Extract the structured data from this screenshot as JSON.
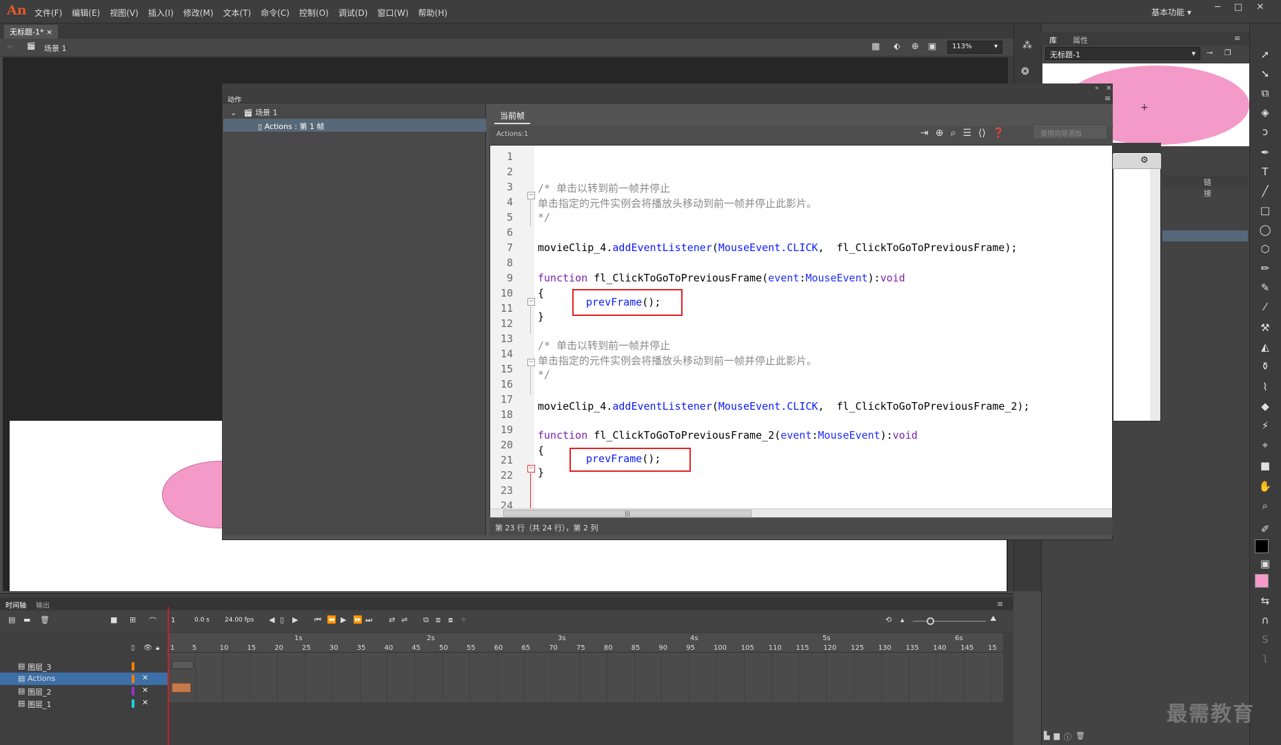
{
  "app": {
    "logo": "An",
    "menu": [
      "文件(F)",
      "编辑(E)",
      "视图(V)",
      "插入(I)",
      "修改(M)",
      "文本(T)",
      "命令(C)",
      "控制(O)",
      "调试(D)",
      "窗口(W)",
      "帮助(H)"
    ],
    "workspace": "基本功能"
  },
  "document": {
    "tab": "无标题-1*",
    "scene": "场景 1",
    "zoom": "113%"
  },
  "actions_panel": {
    "title": "动作",
    "tree_scene": "场景 1",
    "tree_item": "Actions : 第 1 帧",
    "code_tab": "当前帧",
    "code_label": "Actions:1",
    "wizard_button": "使用向导添加",
    "status": "第 23 行（共 24 行），第 2 列"
  },
  "code": {
    "line_numbers": [
      "1",
      "2",
      "3",
      "4",
      "5",
      "6",
      "7",
      "8",
      "9",
      "10",
      "11",
      "12",
      "13",
      "14",
      "15",
      "16",
      "17",
      "18",
      "19",
      "20",
      "21",
      "22",
      "23",
      "24"
    ],
    "comment1": "/* 单击以转到前一帧并停止",
    "comment2": "单击指定的元件实例会将播放头移动到前一帧并停止此影片。",
    "comment3": "*/",
    "l7_a": "movieClip_4.",
    "l7_b": "addEventListener",
    "l7_c": "(",
    "l7_d": "MouseEvent.CLICK",
    "l7_e": ",  fl_ClickToGoToPreviousFrame);",
    "l9_a": "function",
    "l9_b": " fl_ClickToGoToPreviousFrame(",
    "l9_c": "event",
    "l9_d": ":",
    "l9_e": "MouseEvent",
    "l9_f": "):",
    "l9_g": "void",
    "brace_open": "{",
    "brace_close": "}",
    "prev_a": "prevFrame",
    "prev_b": "();",
    "l18_e": ",  fl_ClickToGoToPreviousFrame_2);",
    "l20_b": " fl_ClickToGoToPreviousFrame_2("
  },
  "library": {
    "tab1": "库",
    "tab2": "属性",
    "doc_name": "无标题-1",
    "link_header": "链接"
  },
  "timeline": {
    "tab1": "时间轴",
    "tab2": "输出",
    "frame": "1",
    "time": "0.0 s",
    "fps": "24.00 fps",
    "seconds": [
      "1s",
      "2s",
      "3s",
      "4s",
      "5s",
      "6s"
    ],
    "frame_ticks": [
      "1",
      "5",
      "10",
      "15",
      "20",
      "25",
      "30",
      "35",
      "40",
      "45",
      "50",
      "55",
      "60",
      "65",
      "70",
      "75",
      "80",
      "85",
      "90",
      "95",
      "100",
      "105",
      "110",
      "115",
      "120",
      "125",
      "130",
      "135",
      "140",
      "145",
      "15"
    ],
    "layers": [
      "图层_3",
      "Actions",
      "图层_2",
      "图层_1"
    ],
    "layer_colors": [
      "#ff7f00",
      "#ff7f00",
      "#9b30d0",
      "#20d0e0"
    ]
  },
  "watermark": "最需教育"
}
